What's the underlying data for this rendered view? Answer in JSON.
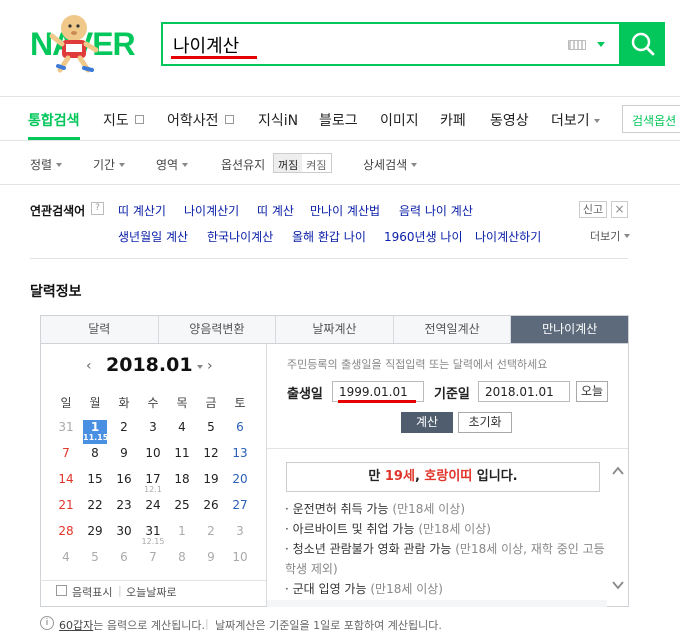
{
  "header": {
    "logo": "NAVER",
    "search_value": "나이계산"
  },
  "tabs": [
    {
      "label": "통합검색"
    },
    {
      "label": "지도"
    },
    {
      "label": "어학사전"
    },
    {
      "label": "지식iN"
    },
    {
      "label": "블로그"
    },
    {
      "label": "이미지"
    },
    {
      "label": "카페"
    },
    {
      "label": "동영상"
    },
    {
      "label": "더보기"
    }
  ],
  "search_options_label": "검색옵션",
  "filters": {
    "sort": "정렬",
    "period": "기간",
    "area": "영역",
    "keep_option": "옵션유지",
    "off": "꺼짐",
    "on": "켜짐",
    "detail": "상세검색"
  },
  "related": {
    "title": "연관검색어",
    "help": "?",
    "items": [
      "띠 계산기",
      "나이계산기",
      "띠 계산",
      "만나이 계산법",
      "음력 나이 계산",
      "생년월일 계산",
      "한국나이계산",
      "올해 환갑 나이",
      "1960년생 나이",
      "나이계산하기"
    ],
    "report": "신고",
    "close": "×",
    "more": "더보기"
  },
  "section_title": "달력정보",
  "widget": {
    "tabs": [
      "달력",
      "양음력변환",
      "날짜계산",
      "전역일계산",
      "만나이계산"
    ],
    "calendar": {
      "month": "2018.01",
      "weekdays": [
        "일",
        "월",
        "화",
        "수",
        "목",
        "금",
        "토"
      ],
      "weeks": [
        [
          {
            "d": "31",
            "t": "gray"
          },
          {
            "d": "1",
            "t": "today",
            "sub": "11.15"
          },
          {
            "d": "2"
          },
          {
            "d": "3"
          },
          {
            "d": "4"
          },
          {
            "d": "5"
          },
          {
            "d": "6",
            "t": "sat"
          }
        ],
        [
          {
            "d": "7",
            "t": "sun"
          },
          {
            "d": "8"
          },
          {
            "d": "9"
          },
          {
            "d": "10"
          },
          {
            "d": "11"
          },
          {
            "d": "12"
          },
          {
            "d": "13",
            "t": "sat"
          }
        ],
        [
          {
            "d": "14",
            "t": "sun"
          },
          {
            "d": "15"
          },
          {
            "d": "16"
          },
          {
            "d": "17",
            "sub": "12.1"
          },
          {
            "d": "18"
          },
          {
            "d": "19"
          },
          {
            "d": "20",
            "t": "sat"
          }
        ],
        [
          {
            "d": "21",
            "t": "sun"
          },
          {
            "d": "22"
          },
          {
            "d": "23"
          },
          {
            "d": "24"
          },
          {
            "d": "25"
          },
          {
            "d": "26"
          },
          {
            "d": "27",
            "t": "sat"
          }
        ],
        [
          {
            "d": "28",
            "t": "sun"
          },
          {
            "d": "29"
          },
          {
            "d": "30"
          },
          {
            "d": "31",
            "sub": "12.15"
          },
          {
            "d": "1",
            "t": "gray"
          },
          {
            "d": "2",
            "t": "gray"
          },
          {
            "d": "3",
            "t": "gray"
          }
        ],
        [
          {
            "d": "4",
            "t": "gray"
          },
          {
            "d": "5",
            "t": "gray"
          },
          {
            "d": "6",
            "t": "gray"
          },
          {
            "d": "7",
            "t": "gray"
          },
          {
            "d": "8",
            "t": "gray"
          },
          {
            "d": "9",
            "t": "gray"
          },
          {
            "d": "10",
            "t": "gray"
          }
        ]
      ],
      "lunar_label": "음력표시",
      "today_label": "오늘날짜로"
    },
    "calc": {
      "note": "주민등록의 출생일을 직접입력 또는 달력에서 선택하세요",
      "birth_label": "출생일",
      "birth_value": "1999.01.01",
      "base_label": "기준일",
      "base_value": "2018.01.01",
      "today_btn": "오늘",
      "calc_btn": "계산",
      "reset_btn": "초기화",
      "result_pre": "만 ",
      "result_age": "19세",
      "result_mid": ", ",
      "result_zodiac": "호랑이띠",
      "result_post": " 입니다.",
      "bullets": [
        {
          "text": "운전면허 취득 가능",
          "note": "(만18세 이상)"
        },
        {
          "text": "아르바이트 및 취업 가능",
          "note": "(만18세 이상)"
        },
        {
          "text": "청소년 관람불가 영화 관람 가능",
          "note": "(만18세 이상, 재학 중인 고등학생 제외)"
        },
        {
          "text": "군대 입영 가능",
          "note": "(만18세 이상)"
        }
      ]
    }
  },
  "footer": {
    "info_icon": "i",
    "ganji": "60갑자",
    "ganji_rest": "는 음력으로 계산됩니다.",
    "date_note": "날짜계산은 기준일을 1일로 포함하여 계산됩니다."
  }
}
